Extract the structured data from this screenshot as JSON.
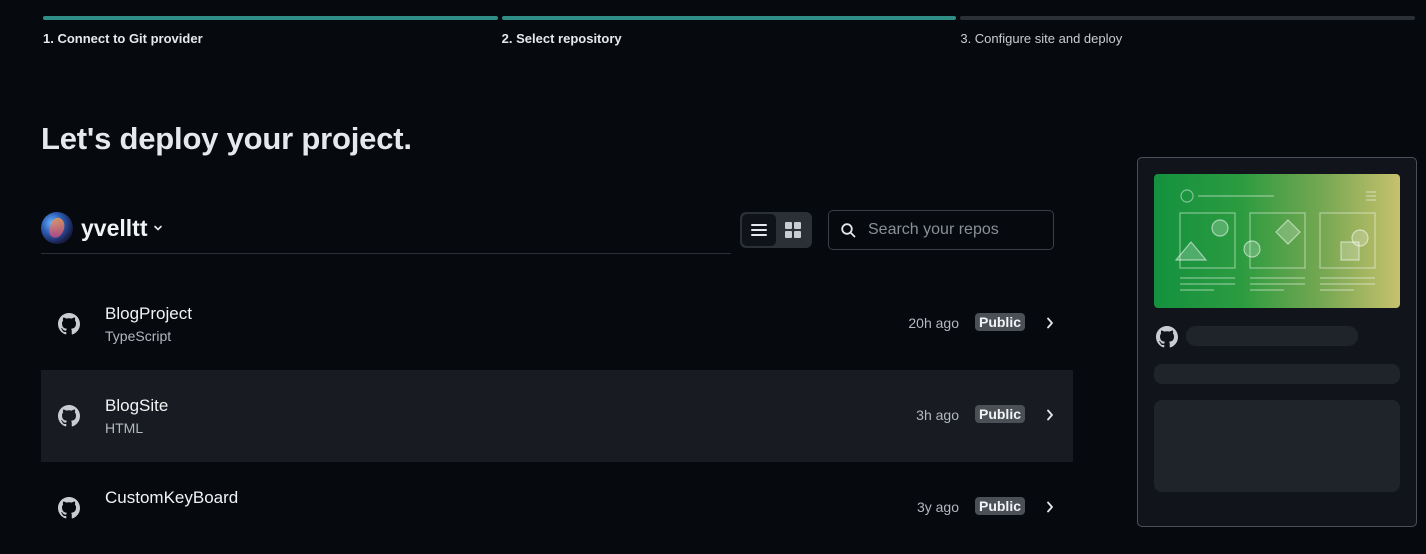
{
  "steps": [
    {
      "label": "1. Connect to Git provider",
      "done": true
    },
    {
      "label": "2. Select repository",
      "done": true
    },
    {
      "label": "3. Configure site and deploy",
      "done": false
    }
  ],
  "page_title": "Let's deploy your project.",
  "account": {
    "name": "yvelltt"
  },
  "search": {
    "placeholder": "Search your repos"
  },
  "repos": [
    {
      "name": "BlogProject",
      "language": "TypeScript",
      "updated": "20h ago",
      "visibility": "Public"
    },
    {
      "name": "BlogSite",
      "language": "HTML",
      "updated": "3h ago",
      "visibility": "Public"
    },
    {
      "name": "CustomKeyBoard",
      "language": "",
      "updated": "3y ago",
      "visibility": "Public"
    }
  ],
  "colors": {
    "accent": "#2f8f87",
    "background": "#06090e",
    "row_hover": "#181c22",
    "badge": "#4b4f56"
  },
  "icons": {
    "repo": "github-icon",
    "list_view": "list-icon",
    "grid_view": "grid-icon",
    "search": "search-icon"
  }
}
